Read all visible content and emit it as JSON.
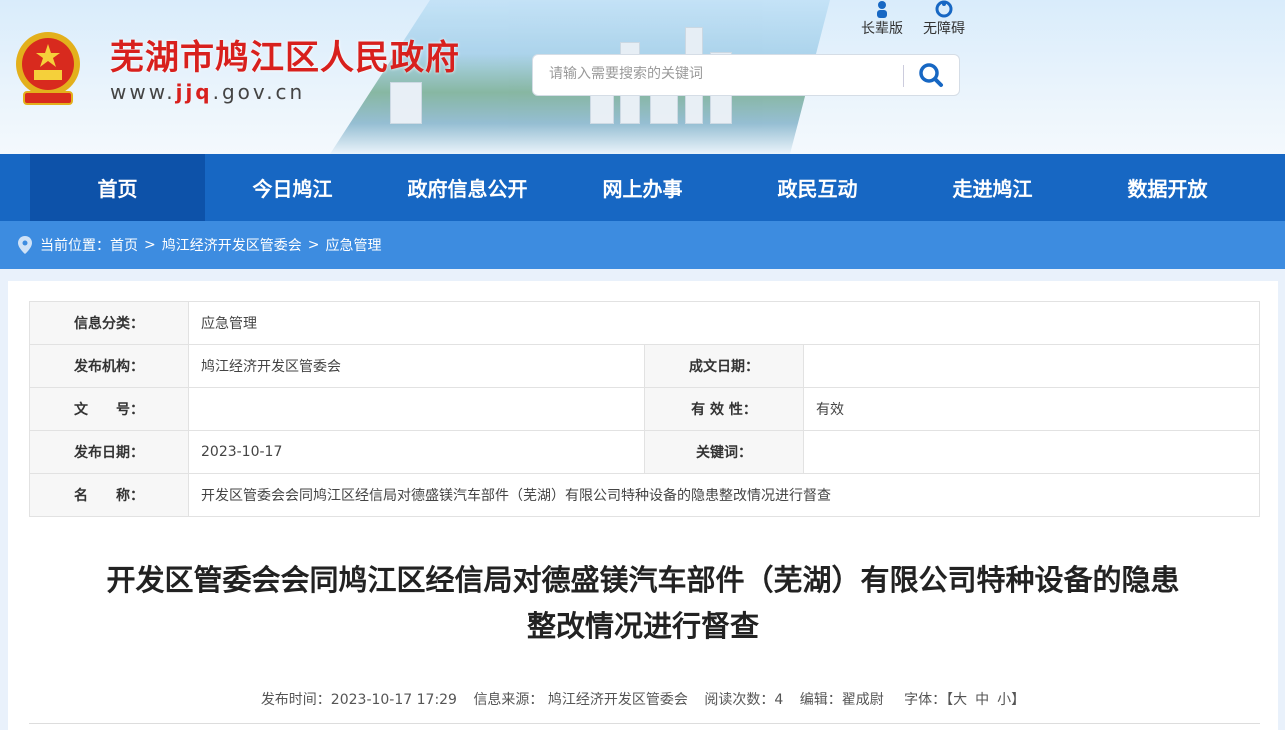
{
  "header": {
    "site_title": "芜湖市鸠江区人民政府",
    "url_prefix": "www.",
    "url_accent": "jjq",
    "url_suffix": ".gov.cn",
    "search_placeholder": "请输入需要搜索的关键词",
    "top_links": [
      "长辈版",
      "无障碍"
    ]
  },
  "nav": {
    "items": [
      "首页",
      "今日鸠江",
      "政府信息公开",
      "网上办事",
      "政民互动",
      "走进鸠江",
      "数据开放"
    ],
    "active_index": 0
  },
  "breadcrumb": {
    "prefix": "当前位置：",
    "items": [
      "首页",
      "鸠江经济开发区管委会",
      "应急管理"
    ],
    "separator": ">"
  },
  "info_table": {
    "category_label": "信息分类：",
    "category_value": "应急管理",
    "publisher_label": "发布机构：",
    "publisher_value": "鸠江经济开发区管委会",
    "created_label": "成文日期：",
    "created_value": "",
    "docno_label": "文　　号：",
    "docno_value": "",
    "validity_label": "有 效 性：",
    "validity_value": "有效",
    "pubdate_label": "发布日期：",
    "pubdate_value": "2023-10-17",
    "keywords_label": "关键词：",
    "keywords_value": "",
    "name_label": "名　　称：",
    "name_value": "开发区管委会会同鸠江区经信局对德盛镁汽车部件（芜湖）有限公司特种设备的隐患整改情况进行督查"
  },
  "article": {
    "title_line1": "开发区管委会会同鸠江区经信局对德盛镁汽车部件（芜湖）有限公司特种设备的隐患",
    "title_line2": "整改情况进行督查",
    "publish_time": "发布时间：2023-10-17 17:29",
    "source": "信息来源： 鸠江经济开发区管委会",
    "read_count": "阅读次数：4",
    "editor": "编辑：翟成尉",
    "font_label": "字体：【",
    "font_large": "大",
    "font_medium": "中",
    "font_small": "小",
    "font_end": "】"
  },
  "colors": {
    "nav_bg": "#1767c3",
    "nav_active": "#0d52a9",
    "breadcrumb_bg": "#3d8ce0",
    "title_red": "#d8201d"
  }
}
